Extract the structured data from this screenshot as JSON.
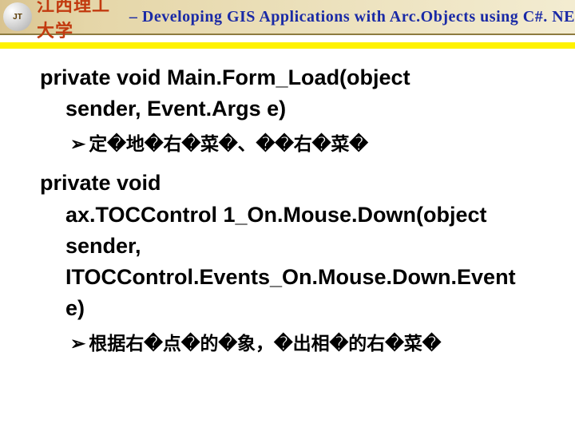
{
  "header": {
    "logo_text": "JT",
    "cn": "江西理工大学",
    "sep": " – ",
    "en": "Developing GIS Applications with Arc.Objects using C#. NE"
  },
  "block1": {
    "sig_prefix": "private void ",
    "sig_name": "Main.Form_Load(object",
    "sig_line2": "sender, Event.Args e)",
    "bullet": "定�地�右�菜�、��右�菜�"
  },
  "block2": {
    "sig_prefix": "private void",
    "sig_line2": "ax.TOCControl 1_On.Mouse.Down(object",
    "sig_line3": "sender,",
    "sig_line4": "ITOCControl.Events_On.Mouse.Down.Event",
    "sig_line5": "e)",
    "bullet": "根据右�点�的�象，�出相�的右�菜�"
  },
  "glyphs": {
    "triangle": "➢"
  }
}
